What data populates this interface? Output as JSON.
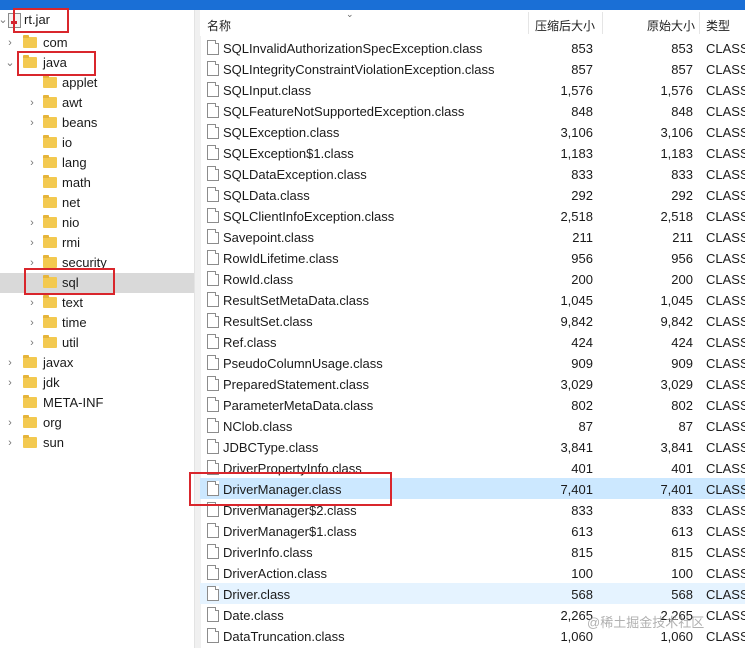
{
  "tree": {
    "root_label": "rt.jar",
    "items": [
      {
        "label": "com"
      },
      {
        "label": "java"
      },
      {
        "label": "applet"
      },
      {
        "label": "awt"
      },
      {
        "label": "beans"
      },
      {
        "label": "io"
      },
      {
        "label": "lang"
      },
      {
        "label": "math"
      },
      {
        "label": "net"
      },
      {
        "label": "nio"
      },
      {
        "label": "rmi"
      },
      {
        "label": "security"
      },
      {
        "label": "sql"
      },
      {
        "label": "text"
      },
      {
        "label": "time"
      },
      {
        "label": "util"
      },
      {
        "label": "javax"
      },
      {
        "label": "jdk"
      },
      {
        "label": "META-INF"
      },
      {
        "label": "org"
      },
      {
        "label": "sun"
      }
    ]
  },
  "list": {
    "columns": {
      "name": "名称",
      "compressed": "压缩后大小",
      "original": "原始大小",
      "type": "类型"
    },
    "rows": [
      {
        "name": "SQLInvalidAuthorizationSpecException.class",
        "compressed": "853",
        "original": "853",
        "type": "CLASS"
      },
      {
        "name": "SQLIntegrityConstraintViolationException.class",
        "compressed": "857",
        "original": "857",
        "type": "CLASS"
      },
      {
        "name": "SQLInput.class",
        "compressed": "1,576",
        "original": "1,576",
        "type": "CLASS"
      },
      {
        "name": "SQLFeatureNotSupportedException.class",
        "compressed": "848",
        "original": "848",
        "type": "CLASS"
      },
      {
        "name": "SQLException.class",
        "compressed": "3,106",
        "original": "3,106",
        "type": "CLASS"
      },
      {
        "name": "SQLException$1.class",
        "compressed": "1,183",
        "original": "1,183",
        "type": "CLASS"
      },
      {
        "name": "SQLDataException.class",
        "compressed": "833",
        "original": "833",
        "type": "CLASS"
      },
      {
        "name": "SQLData.class",
        "compressed": "292",
        "original": "292",
        "type": "CLASS"
      },
      {
        "name": "SQLClientInfoException.class",
        "compressed": "2,518",
        "original": "2,518",
        "type": "CLASS"
      },
      {
        "name": "Savepoint.class",
        "compressed": "211",
        "original": "211",
        "type": "CLASS"
      },
      {
        "name": "RowIdLifetime.class",
        "compressed": "956",
        "original": "956",
        "type": "CLASS"
      },
      {
        "name": "RowId.class",
        "compressed": "200",
        "original": "200",
        "type": "CLASS"
      },
      {
        "name": "ResultSetMetaData.class",
        "compressed": "1,045",
        "original": "1,045",
        "type": "CLASS"
      },
      {
        "name": "ResultSet.class",
        "compressed": "9,842",
        "original": "9,842",
        "type": "CLASS"
      },
      {
        "name": "Ref.class",
        "compressed": "424",
        "original": "424",
        "type": "CLASS"
      },
      {
        "name": "PseudoColumnUsage.class",
        "compressed": "909",
        "original": "909",
        "type": "CLASS"
      },
      {
        "name": "PreparedStatement.class",
        "compressed": "3,029",
        "original": "3,029",
        "type": "CLASS"
      },
      {
        "name": "ParameterMetaData.class",
        "compressed": "802",
        "original": "802",
        "type": "CLASS"
      },
      {
        "name": "NClob.class",
        "compressed": "87",
        "original": "87",
        "type": "CLASS"
      },
      {
        "name": "JDBCType.class",
        "compressed": "3,841",
        "original": "3,841",
        "type": "CLASS"
      },
      {
        "name": "DriverPropertyInfo.class",
        "compressed": "401",
        "original": "401",
        "type": "CLASS"
      },
      {
        "name": "DriverManager.class",
        "compressed": "7,401",
        "original": "7,401",
        "type": "CLASS"
      },
      {
        "name": "DriverManager$2.class",
        "compressed": "833",
        "original": "833",
        "type": "CLASS"
      },
      {
        "name": "DriverManager$1.class",
        "compressed": "613",
        "original": "613",
        "type": "CLASS"
      },
      {
        "name": "DriverInfo.class",
        "compressed": "815",
        "original": "815",
        "type": "CLASS"
      },
      {
        "name": "DriverAction.class",
        "compressed": "100",
        "original": "100",
        "type": "CLASS"
      },
      {
        "name": "Driver.class",
        "compressed": "568",
        "original": "568",
        "type": "CLASS"
      },
      {
        "name": "Date.class",
        "compressed": "2,265",
        "original": "2,265",
        "type": "CLASS"
      },
      {
        "name": "DataTruncation.class",
        "compressed": "1,060",
        "original": "1,060",
        "type": "CLASS"
      }
    ]
  },
  "watermark": "@稀土掘金技术社区"
}
